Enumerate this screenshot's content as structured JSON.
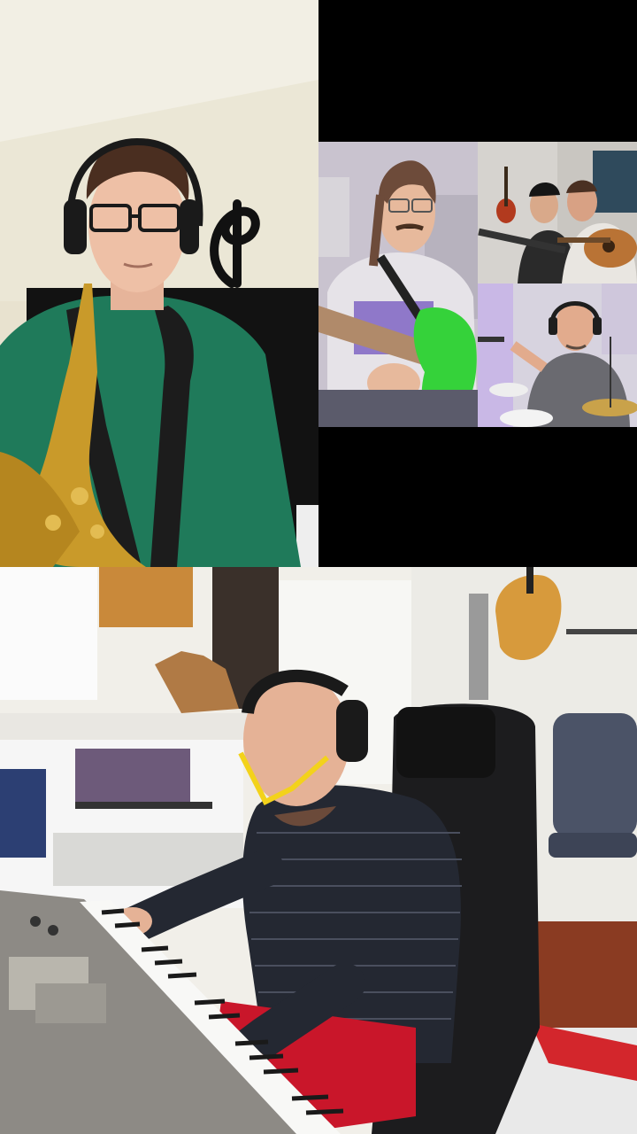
{
  "tiles": {
    "saxophonist": {
      "role": "saxophone player"
    },
    "band_grid": {
      "bassist": {
        "role": "bass player"
      },
      "guitarists": {
        "role": "guitar duo"
      },
      "drummer": {
        "role": "drummer"
      }
    },
    "keyboardist": {
      "role": "keyboard player"
    }
  },
  "colors": {
    "background": "#000000",
    "green_sweater": "#1f7a5a",
    "sax_brass": "#c99a2a",
    "bass_green": "#35d23a",
    "carpet_red": "#d3262c",
    "wall_cream": "#ebe7d6"
  }
}
